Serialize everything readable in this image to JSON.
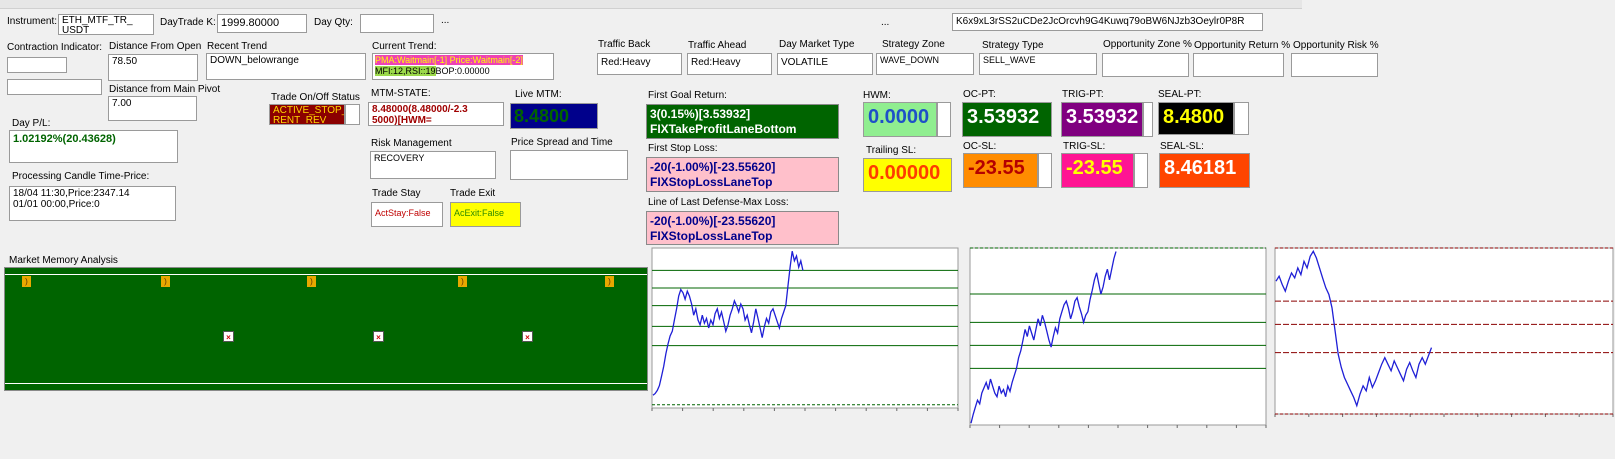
{
  "row1": {
    "instrument_label": "Instrument:",
    "instrument_value": "ETH_MTF_TR_\nUSDT",
    "daytrade_label": "DayTrade K:",
    "daytrade_value": "1999.80000",
    "dayqty_label": "Day Qty:",
    "dayqty_value": "",
    "ellipsis1": "...",
    "ellipsis2": "...",
    "key_value": "K6x9xL3rSS2uCDe2JcOrcvh9G4Kuwq79oBW6NJzb3Oeylr0P8R"
  },
  "row2": {
    "contraction_label": "Contraction Indicator:",
    "contraction_value": "",
    "dist_open_label": "Distance From Open",
    "dist_open_value": "78.50",
    "recent_trend_label": "Recent Trend",
    "recent_trend_value": "DOWN_belowrange",
    "current_trend_label": "Current Trend:",
    "current_trend_line1": "PMA:Waitmain[-1] Price:Waitmain[-2]",
    "current_trend_line2_mfi": "MFI:12,RSI::19",
    "current_trend_line2_bop": "BOP:0.00000",
    "traffic_back_label": "Traffic Back",
    "traffic_back_value": "Red:Heavy",
    "traffic_ahead_label": "Traffic Ahead",
    "traffic_ahead_value": "Red:Heavy",
    "day_market_label": "Day Market Type",
    "day_market_value": "VOLATILE",
    "strategy_zone_label": "Strategy Zone",
    "strategy_zone_value": "WAVE_DOWN",
    "strategy_type_label": "Strategy Type",
    "strategy_type_value": "SELL_WAVE",
    "opp_zone_label": "Opportunity Zone %",
    "opp_return_label": "Opportunity Return %",
    "opp_risk_label": "Opportunity Risk %"
  },
  "row3": {
    "dist_pivot_label": "Distance from Main Pivot",
    "dist_pivot_value": "7.00",
    "trade_onoff_label": "Trade On/Off Status",
    "trade_onoff_value": "ACTIVE_STOP_\nRENT_REV",
    "mtm_state_label": "MTM-STATE:",
    "mtm_state_value": "8.48000(8.48000/-2.3\n5000)[HWM=",
    "live_mtm_label": "Live MTM:",
    "live_mtm_value": "8.4800",
    "first_goal_label": "First Goal Return:",
    "first_goal_value": "3(0.15%)[3.53932]\nFIXTakeProfitLaneBottom",
    "hwm_label": "HWM:",
    "hwm_value": "0.0000",
    "ocpt_label": "OC-PT:",
    "ocpt_value": "3.53932",
    "trigpt_label": "TRIG-PT:",
    "trigpt_value": "3.53932",
    "sealpt_label": "SEAL-PT:",
    "sealpt_value": "8.4800"
  },
  "row4": {
    "day_pl_label": "Day P/L:",
    "day_pl_value": "1.02192%(20.43628)",
    "risk_label": "Risk Management",
    "risk_value": "RECOVERY",
    "spread_label": "Price Spread and Time",
    "spread_value": "",
    "first_stop_label": "First Stop Loss:",
    "first_stop_value": "-20(-1.00%)[-23.55620]\nFIXStopLossLaneTop",
    "trailing_label": "Trailing SL:",
    "trailing_value": "0.00000",
    "ocsl_label": "OC-SL:",
    "ocsl_value": "-23.55",
    "trigsl_label": "TRIG-SL:",
    "trigsl_value": "-23.55",
    "sealsl_label": "SEAL-SL:",
    "sealsl_value": "8.46181"
  },
  "row5": {
    "candle_label": "Processing Candle Time-Price:",
    "candle_value": "18/04 11:30,Price:2347.14\n01/01 00:00,Price:0",
    "trade_stay_label": "Trade Stay",
    "trade_stay_value": "ActStay:False",
    "trade_exit_label": "Trade Exit",
    "trade_exit_value": "AcExit:False",
    "last_defense_label": "Line of Last Defense-Max Loss:",
    "last_defense_value": "-20(-1.00%)[-23.55620]\nFIXStopLossLaneTop"
  },
  "market_memory": {
    "title": "Market Memory Analysis",
    "bracket_marks": [
      ")",
      ")",
      ")",
      ")",
      ")"
    ],
    "x_marks": [
      "×",
      "×",
      "×"
    ]
  },
  "colors": {
    "accent_green": "#006400",
    "panel_pink": "#ffc0cb",
    "hwm_bg": "#90ee90",
    "trailing_bg": "#ffff00",
    "orange": "#ff8c00",
    "magenta": "#ff1493",
    "orangered": "#ff4500"
  },
  "charts": [
    {
      "hlines": [
        0.14,
        0.25,
        0.36,
        0.49,
        0.61,
        0.98
      ],
      "price": [
        0.92,
        0.91,
        0.89,
        0.86,
        0.8,
        0.74,
        0.66,
        0.6,
        0.55,
        0.52,
        0.45,
        0.38,
        0.3,
        0.26,
        0.28,
        0.32,
        0.27,
        0.3,
        0.35,
        0.42,
        0.38,
        0.45,
        0.48,
        0.42,
        0.47,
        0.44,
        0.5,
        0.45,
        0.48,
        0.41,
        0.38,
        0.44,
        0.4,
        0.46,
        0.52,
        0.48,
        0.42,
        0.38,
        0.33,
        0.36,
        0.4,
        0.35,
        0.38,
        0.45,
        0.42,
        0.48,
        0.53,
        0.46,
        0.38,
        0.44,
        0.5,
        0.56,
        0.49,
        0.44,
        0.47,
        0.4,
        0.38,
        0.42,
        0.46,
        0.5,
        0.44,
        0.4,
        0.36,
        0.24,
        0.12,
        0.02,
        0.08,
        0.05,
        0.12,
        0.08,
        0.14
      ]
    },
    {
      "hlines": [
        0.0,
        0.26,
        0.42,
        0.55,
        0.68
      ],
      "price": [
        0.99,
        0.94,
        0.9,
        0.86,
        0.88,
        0.82,
        0.79,
        0.76,
        0.8,
        0.74,
        0.78,
        0.82,
        0.84,
        0.78,
        0.82,
        0.8,
        0.84,
        0.78,
        0.81,
        0.76,
        0.72,
        0.68,
        0.62,
        0.58,
        0.52,
        0.46,
        0.5,
        0.44,
        0.48,
        0.52,
        0.46,
        0.4,
        0.44,
        0.38,
        0.42,
        0.47,
        0.52,
        0.56,
        0.5,
        0.45,
        0.48,
        0.4,
        0.36,
        0.32,
        0.3,
        0.34,
        0.4,
        0.36,
        0.3,
        0.28,
        0.33,
        0.37,
        0.42,
        0.38,
        0.36,
        0.29,
        0.24,
        0.18,
        0.14,
        0.2,
        0.26,
        0.22,
        0.16,
        0.12,
        0.18,
        0.12,
        0.06,
        0.02
      ]
    },
    {
      "hlines": [
        0.0,
        0.32,
        0.46,
        0.63,
        1.0
      ],
      "price": [
        0.2,
        0.17,
        0.22,
        0.26,
        0.2,
        0.15,
        0.18,
        0.12,
        0.16,
        0.08,
        0.12,
        0.05,
        0.02,
        0.06,
        0.12,
        0.18,
        0.24,
        0.28,
        0.36,
        0.5,
        0.64,
        0.72,
        0.78,
        0.82,
        0.86,
        0.9,
        0.95,
        0.88,
        0.83,
        0.86,
        0.78,
        0.84,
        0.8,
        0.75,
        0.7,
        0.66,
        0.7,
        0.74,
        0.68,
        0.72,
        0.76,
        0.8,
        0.73,
        0.69,
        0.74,
        0.78,
        0.7,
        0.66,
        0.7,
        0.65,
        0.6
      ]
    }
  ]
}
